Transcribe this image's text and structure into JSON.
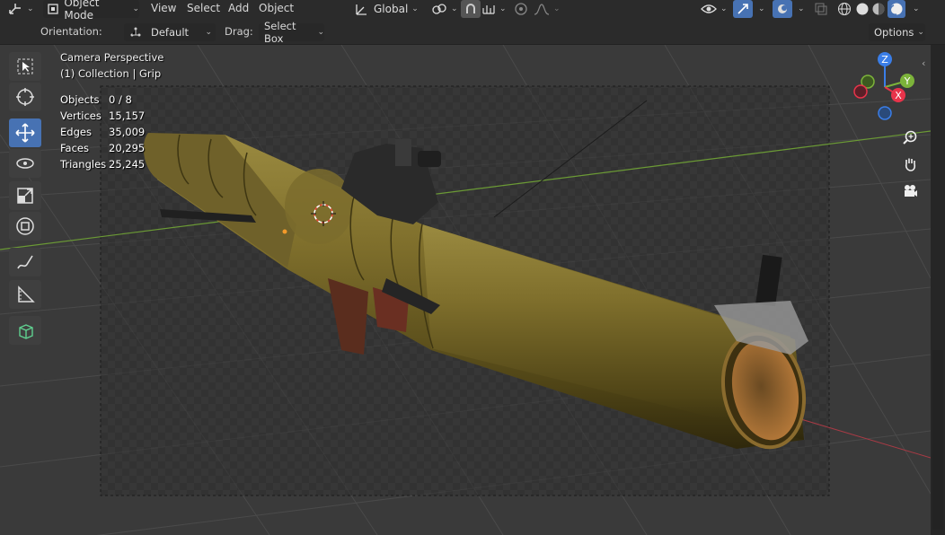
{
  "header": {
    "editor_type_icon": "axes-editor-icon",
    "mode_label": "Object Mode",
    "menus": [
      "View",
      "Select",
      "Add",
      "Object"
    ],
    "transform_orientation": "Global",
    "icons": [
      "link-icon",
      "snap-magnet-icon",
      "snap-increment-icon",
      "proportional-edit-icon",
      "falloff-curve-icon",
      "visibility-eye-icon",
      "gizmo-arrow-icon",
      "overlay-icon",
      "xray-icon",
      "wireframe-shading-icon",
      "solid-shading-icon",
      "material-shading-icon",
      "rendered-shading-icon"
    ]
  },
  "tool_settings": {
    "orientation_label": "Orientation:",
    "orientation_value": "Default",
    "drag_label": "Drag:",
    "drag_value": "Select Box",
    "options_label": "Options"
  },
  "viewport": {
    "view_name": "Camera Perspective",
    "collection_info": "(1) Collection | Grip",
    "stats": [
      {
        "label": "Objects",
        "value": "0 / 8"
      },
      {
        "label": "Vertices",
        "value": "15,157"
      },
      {
        "label": "Edges",
        "value": "35,009"
      },
      {
        "label": "Faces",
        "value": "20,295"
      },
      {
        "label": "Triangles",
        "value": "25,245"
      }
    ],
    "gizmo": {
      "z": "Z",
      "y": "Y",
      "x": "X"
    },
    "colors": {
      "axis_x": "#e8334a",
      "axis_y": "#7cb33a",
      "axis_z": "#3a7ee8",
      "active_tool": "#4772b3",
      "object_olive": "#7a6a2a"
    }
  },
  "toolbar": {
    "tools": [
      "select-box-icon",
      "cursor-icon",
      "move-icon",
      "rotate-icon",
      "scale-icon",
      "transform-icon",
      "annotate-icon",
      "measure-icon",
      "add-cube-icon"
    ],
    "active_index": 2
  }
}
